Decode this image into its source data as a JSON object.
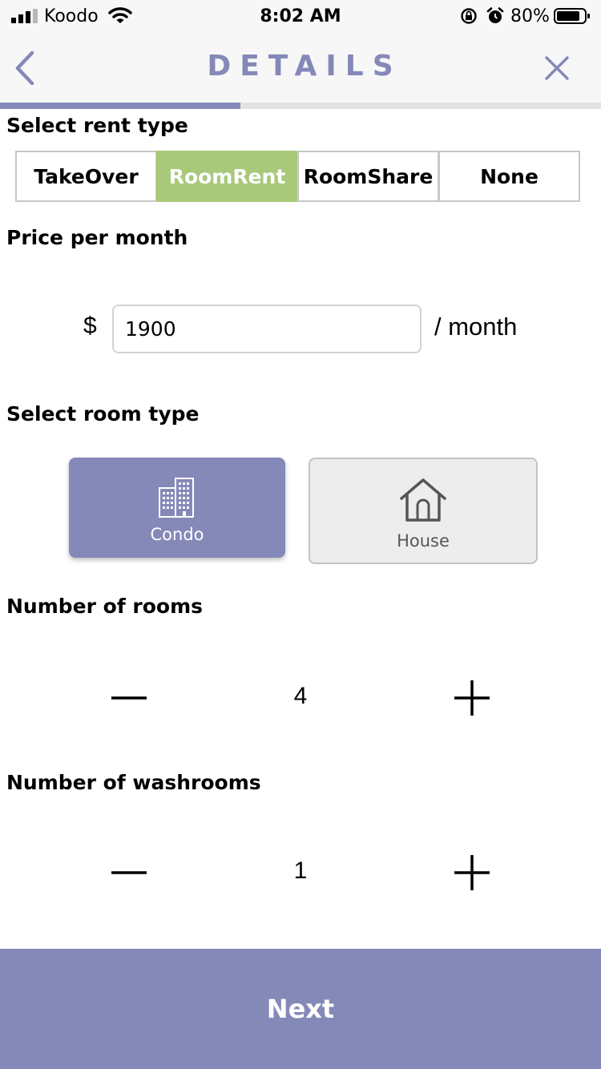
{
  "status_bar": {
    "carrier": "Koodo",
    "time": "8:02 AM",
    "battery_percent": "80%",
    "icons": [
      "signal-icon",
      "wifi-icon",
      "rotation-lock-icon",
      "alarm-icon",
      "battery-icon"
    ]
  },
  "nav": {
    "title": "DETAILS",
    "back_icon": "chevron-left-icon",
    "close_icon": "close-icon",
    "progress": 0.4
  },
  "rent_type": {
    "label": "Select rent type",
    "options": [
      "TakeOver",
      "RoomRent",
      "RoomShare",
      "None"
    ],
    "selected": "RoomRent"
  },
  "price": {
    "label": "Price per month",
    "currency": "$",
    "value": "1900",
    "suffix": "/ month"
  },
  "room_type": {
    "label": "Select room type",
    "options": [
      {
        "label": "Condo",
        "icon": "building-icon"
      },
      {
        "label": "House",
        "icon": "house-icon"
      }
    ],
    "selected": "Condo"
  },
  "rooms": {
    "label": "Number of rooms",
    "value": "4"
  },
  "washrooms": {
    "label": "Number of washrooms",
    "value": "1"
  },
  "next_label": "Next",
  "colors": {
    "accent": "#8589b8",
    "selected_green": "#a8c97a",
    "card_grey": "#ededed"
  }
}
